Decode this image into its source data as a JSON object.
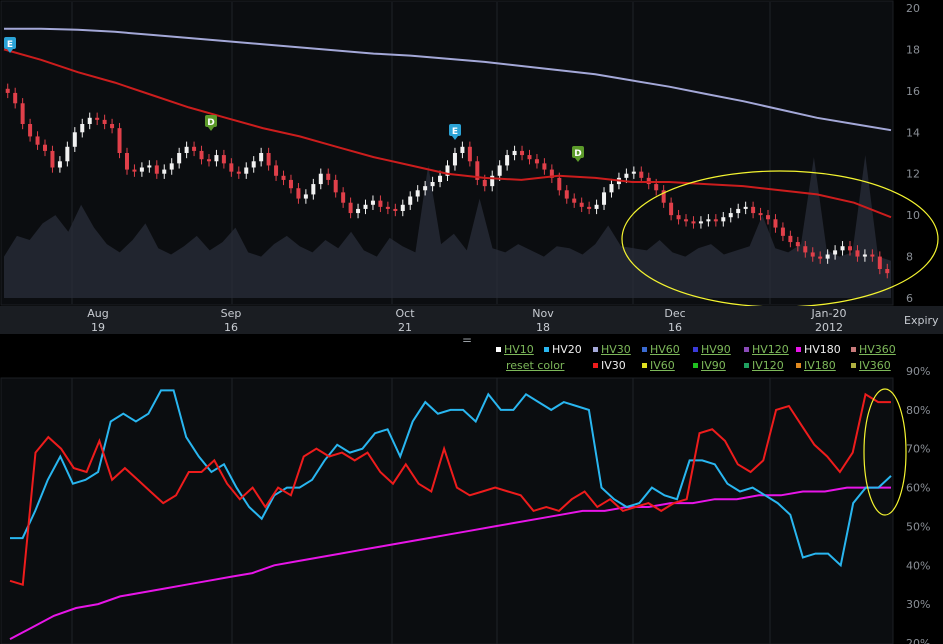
{
  "colors": {
    "background": "#000000",
    "panel": "#0b0d10",
    "grid": "#1f2328",
    "axis_text": "#8a8f96",
    "up_candle": "#f2f2f2",
    "down_candle": "#e0404a",
    "hv30_line": "#a4a8d8",
    "iv30_price_line": "#cc1d1d",
    "volume_area": "#2a2e3a",
    "hv20": "#29b6f0",
    "iv30": "#ee1c1c",
    "hv180": "#e815e8",
    "highlight": "#f4f430"
  },
  "top_panel": {
    "y_ticks": [
      "20",
      "18",
      "16",
      "14",
      "12",
      "10",
      "8",
      "6"
    ],
    "x_labels": [
      {
        "month": "Aug",
        "day": "19"
      },
      {
        "month": "Sep",
        "day": "16"
      },
      {
        "month": "Oct",
        "day": "21"
      },
      {
        "month": "Nov",
        "day": "18"
      },
      {
        "month": "Dec",
        "day": "16"
      },
      {
        "month": "Jan-20",
        "day": "2012"
      }
    ],
    "expiry_label": "Expiry",
    "event_markers": [
      {
        "letter": "E",
        "kind": "earnings",
        "color": "#2ba3d6"
      },
      {
        "letter": "D",
        "kind": "dividend",
        "color": "#5c9a2a"
      },
      {
        "letter": "E",
        "kind": "earnings",
        "color": "#2ba3d6"
      },
      {
        "letter": "D",
        "kind": "dividend",
        "color": "#5c9a2a"
      }
    ],
    "drag_handle": "="
  },
  "legend": {
    "row1": [
      {
        "label": "HV10",
        "link": true,
        "color": "#ffffff"
      },
      {
        "label": "HV20",
        "link": false,
        "color": "#29b6f0"
      },
      {
        "label": "HV30",
        "link": true,
        "color": "#a4a8d8"
      },
      {
        "label": "HV60",
        "link": true,
        "color": "#3a6ad0"
      },
      {
        "label": "HV90",
        "link": true,
        "color": "#3a3ad8"
      },
      {
        "label": "HV120",
        "link": true,
        "color": "#8a4ab8"
      },
      {
        "label": "HV180",
        "link": false,
        "color": "#e815e8"
      },
      {
        "label": "HV360",
        "link": true,
        "color": "#c87a7a"
      }
    ],
    "reset_label": "reset color",
    "row2": [
      {
        "label": "IV30",
        "link": false,
        "color": "#ee1c1c"
      },
      {
        "label": "IV60",
        "link": true,
        "color": "#e0e020"
      },
      {
        "label": "IV90",
        "link": true,
        "color": "#20c020"
      },
      {
        "label": "IV120",
        "link": true,
        "color": "#20a060"
      },
      {
        "label": "IV180",
        "link": true,
        "color": "#e08a20"
      },
      {
        "label": "IV360",
        "link": true,
        "color": "#b0b040"
      }
    ]
  },
  "chart_data": [
    {
      "type": "candlestick",
      "name": "Stock price",
      "ylim": [
        6,
        20
      ],
      "y_ticks": [
        20,
        18,
        16,
        14,
        12,
        10,
        8,
        6
      ],
      "x_tick_labels": [
        "Aug 19",
        "Sep 16",
        "Oct 21",
        "Nov 18",
        "Dec 16",
        "Jan-20 2012"
      ],
      "close": [
        15.9,
        15.4,
        14.4,
        13.8,
        13.4,
        13.1,
        12.3,
        12.6,
        13.3,
        14.0,
        14.4,
        14.7,
        14.6,
        14.4,
        14.2,
        13.0,
        12.2,
        12.1,
        12.3,
        12.4,
        12.0,
        12.2,
        12.5,
        13.0,
        13.3,
        13.1,
        12.7,
        12.6,
        12.9,
        12.5,
        12.1,
        12.0,
        12.3,
        12.6,
        13.0,
        12.4,
        11.9,
        11.7,
        11.3,
        10.8,
        11.0,
        11.5,
        12.0,
        11.7,
        11.1,
        10.6,
        10.1,
        10.3,
        10.5,
        10.7,
        10.4,
        10.3,
        10.2,
        10.5,
        10.9,
        11.2,
        11.4,
        11.6,
        11.9,
        12.4,
        13.0,
        13.3,
        12.6,
        11.7,
        11.4,
        11.9,
        12.4,
        12.9,
        13.1,
        12.9,
        12.7,
        12.5,
        12.2,
        11.8,
        11.2,
        10.8,
        10.6,
        10.4,
        10.3,
        10.5,
        11.1,
        11.5,
        11.8,
        12.0,
        12.1,
        11.8,
        11.5,
        11.2,
        10.6,
        10.0,
        9.8,
        9.7,
        9.6,
        9.7,
        9.8,
        9.7,
        9.9,
        10.1,
        10.3,
        10.4,
        10.1,
        10.0,
        9.8,
        9.4,
        9.0,
        8.7,
        8.5,
        8.2,
        8.0,
        7.9,
        8.1,
        8.3,
        8.5,
        8.3,
        8.0,
        8.1,
        8.0,
        7.4,
        7.2
      ]
    },
    {
      "type": "line",
      "name": "HV30",
      "ylim": [
        6,
        20
      ],
      "y": [
        19.0,
        19.0,
        18.95,
        18.85,
        18.7,
        18.55,
        18.4,
        18.25,
        18.1,
        17.95,
        17.8,
        17.7,
        17.55,
        17.4,
        17.2,
        17.0,
        16.8,
        16.5,
        16.2,
        15.85,
        15.5,
        15.1,
        14.7,
        14.4,
        14.1
      ]
    },
    {
      "type": "line",
      "name": "IV30",
      "ylim": [
        6,
        20
      ],
      "y": [
        18.0,
        17.5,
        16.9,
        16.4,
        15.8,
        15.2,
        14.7,
        14.2,
        13.8,
        13.3,
        12.8,
        12.4,
        12.0,
        11.8,
        11.7,
        11.9,
        11.8,
        11.6,
        11.6,
        11.5,
        11.4,
        11.2,
        11.0,
        10.6,
        9.9
      ]
    },
    {
      "type": "line",
      "ylim": [
        20,
        90
      ],
      "y_ticks": [
        90,
        80,
        70,
        60,
        50,
        40,
        30,
        20
      ],
      "series": [
        {
          "name": "HV20",
          "values": [
            47,
            47,
            54,
            62,
            68,
            61,
            62,
            64,
            77,
            79,
            77,
            79,
            85,
            85,
            73,
            68,
            64,
            66,
            60,
            55,
            52,
            58,
            60,
            60,
            62,
            67,
            71,
            69,
            70,
            74,
            75,
            68,
            77,
            82,
            79,
            80,
            80,
            77,
            84,
            80,
            80,
            84,
            82,
            80,
            82,
            81,
            80,
            60,
            57,
            55,
            56,
            60,
            58,
            57,
            67,
            67,
            66,
            61,
            59,
            60,
            58,
            56,
            53,
            42,
            43,
            43,
            40,
            56,
            60,
            60,
            63
          ]
        },
        {
          "name": "IV30",
          "values": [
            36,
            35,
            69,
            73,
            70,
            65,
            64,
            72,
            62,
            65,
            62,
            59,
            56,
            58,
            64,
            64,
            67,
            61,
            57,
            60,
            55,
            60,
            58,
            68,
            70,
            68,
            69,
            67,
            69,
            64,
            61,
            66,
            61,
            59,
            70,
            60,
            58,
            59,
            60,
            59,
            58,
            54,
            55,
            54,
            57,
            59,
            55,
            57,
            54,
            55,
            56,
            54,
            56,
            57,
            74,
            75,
            72,
            66,
            64,
            67,
            80,
            81,
            76,
            71,
            68,
            64,
            69,
            84,
            82,
            82
          ]
        },
        {
          "name": "HV180",
          "values": [
            21,
            24,
            27,
            29,
            30,
            32,
            33,
            34,
            35,
            36,
            37,
            38,
            40,
            41,
            42,
            43,
            44,
            45,
            46,
            47,
            48,
            49,
            50,
            51,
            52,
            53,
            54,
            54,
            55,
            55,
            56,
            56,
            57,
            57,
            58,
            58,
            59,
            59,
            60,
            60,
            60
          ]
        }
      ]
    }
  ]
}
